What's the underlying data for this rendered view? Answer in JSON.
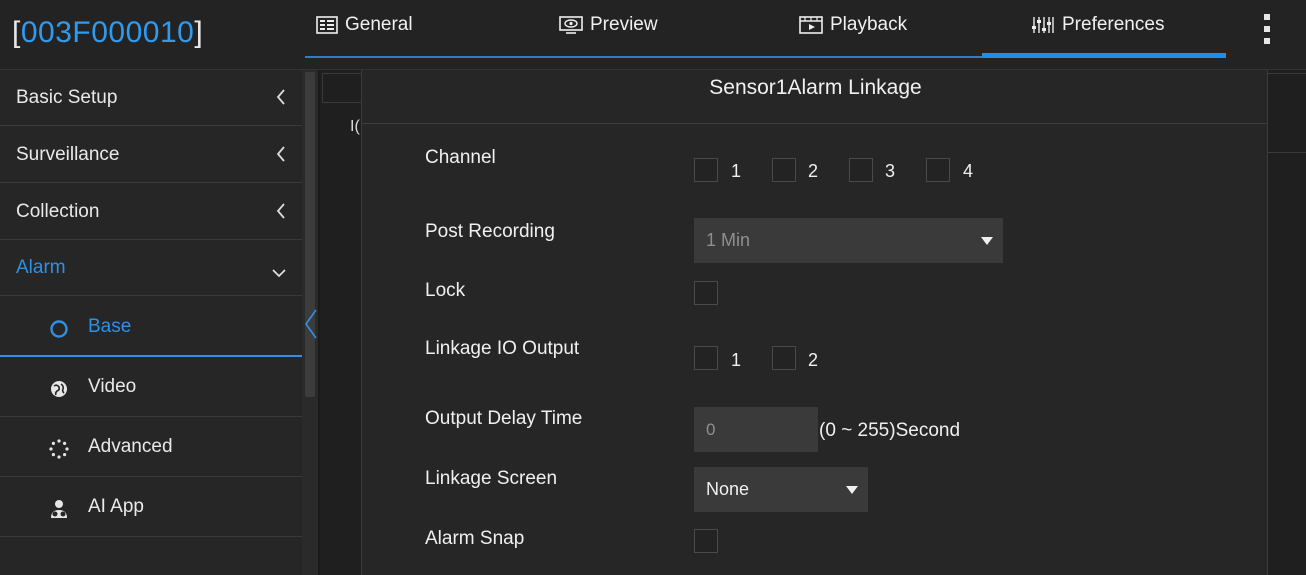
{
  "header": {
    "device_bracket_open": "[",
    "device_id": "003F000010",
    "device_bracket_close": "]",
    "tabs": [
      {
        "label": "General",
        "icon": "general-icon"
      },
      {
        "label": "Preview",
        "icon": "preview-icon"
      },
      {
        "label": "Playback",
        "icon": "playback-icon"
      },
      {
        "label": "Preferences",
        "icon": "preferences-icon",
        "active": true
      }
    ],
    "more_icon": "kebab-menu-icon"
  },
  "sidebar": {
    "items": [
      {
        "label": "Basic Setup",
        "expanded": false
      },
      {
        "label": "Surveillance",
        "expanded": false
      },
      {
        "label": "Collection",
        "expanded": false
      },
      {
        "label": "Alarm",
        "expanded": true
      }
    ],
    "sub_items": [
      {
        "label": "Base",
        "icon": "circle-icon",
        "active": true
      },
      {
        "label": "Video",
        "icon": "globe-icon"
      },
      {
        "label": "Advanced",
        "icon": "dots-circle-icon"
      },
      {
        "label": "AI App",
        "icon": "people-icon"
      }
    ]
  },
  "background": {
    "io_label": "I("
  },
  "dialog": {
    "title": "Sensor1Alarm Linkage",
    "channel": {
      "label": "Channel",
      "options": [
        "1",
        "2",
        "3",
        "4"
      ]
    },
    "post_recording": {
      "label": "Post Recording",
      "value": "1 Min"
    },
    "lock": {
      "label": "Lock"
    },
    "linkage_io_output": {
      "label": "Linkage IO Output",
      "options": [
        "1",
        "2"
      ]
    },
    "output_delay_time": {
      "label": "Output Delay Time",
      "value": "0",
      "unit": "(0 ~ 255)Second"
    },
    "linkage_screen": {
      "label": "Linkage Screen",
      "value": "None"
    },
    "alarm_snap": {
      "label": "Alarm Snap"
    }
  },
  "colors": {
    "accent": "#2f90e6",
    "background": "#1b1b1b",
    "panel": "#262626",
    "field": "#3a3a3a"
  }
}
